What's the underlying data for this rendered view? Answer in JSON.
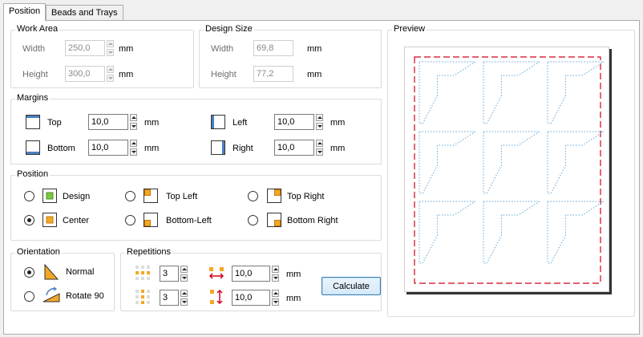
{
  "tabs": [
    {
      "label": "Position",
      "active": true
    },
    {
      "label": "Beads and Trays",
      "active": false
    }
  ],
  "work_area": {
    "title": "Work Area",
    "width_label": "Width",
    "width_value": "250,0",
    "width_unit": "mm",
    "height_label": "Height",
    "height_value": "300,0",
    "height_unit": "mm"
  },
  "design_size": {
    "title": "Design Size",
    "width_label": "Width",
    "width_value": "69,8",
    "width_unit": "mm",
    "height_label": "Height",
    "height_value": "77,2",
    "height_unit": "mm"
  },
  "margins": {
    "title": "Margins",
    "top_label": "Top",
    "top_value": "10,0",
    "top_unit": "mm",
    "bottom_label": "Bottom",
    "bottom_value": "10,0",
    "bottom_unit": "mm",
    "left_label": "Left",
    "left_value": "10,0",
    "left_unit": "mm",
    "right_label": "Right",
    "right_value": "10,0",
    "right_unit": "mm"
  },
  "position": {
    "title": "Position",
    "options": [
      {
        "label": "Design",
        "checked": false
      },
      {
        "label": "Top Left",
        "checked": false
      },
      {
        "label": "Top Right",
        "checked": false
      },
      {
        "label": "Center",
        "checked": true
      },
      {
        "label": "Bottom-Left",
        "checked": false
      },
      {
        "label": "Bottom Right",
        "checked": false
      }
    ]
  },
  "orientation": {
    "title": "Orientation",
    "normal_label": "Normal",
    "normal_checked": true,
    "rotate_label": "Rotate 90",
    "rotate_checked": false
  },
  "repetitions": {
    "title": "Repetitions",
    "cols_value": "3",
    "rows_value": "3",
    "h_spacing_value": "10,0",
    "h_spacing_unit": "mm",
    "v_spacing_value": "10,0",
    "v_spacing_unit": "mm",
    "calculate_label": "Calculate"
  },
  "preview": {
    "title": "Preview",
    "margin_color": "#d0021b",
    "design_outline_color": "#5fa8d8",
    "grid_rows": 3,
    "grid_cols": 3
  }
}
